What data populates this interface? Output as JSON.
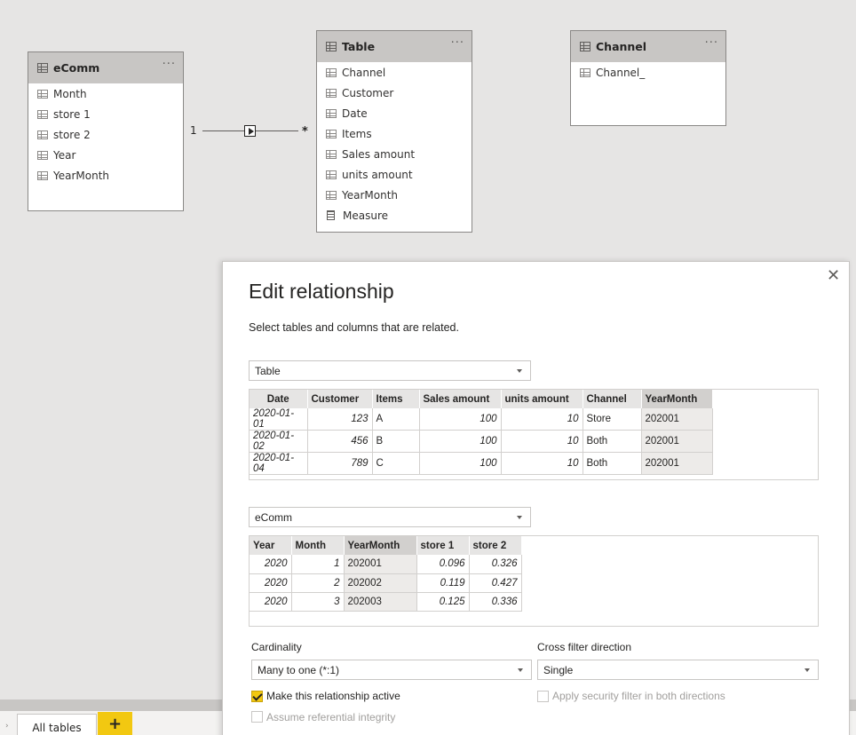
{
  "model": {
    "ecomm": {
      "title": "eComm",
      "more": "···",
      "fields": [
        "Month",
        "store 1",
        "store 2",
        "Year",
        "YearMonth"
      ]
    },
    "table": {
      "title": "Table",
      "more": "···",
      "fields": [
        "Channel",
        "Customer",
        "Date",
        "Items",
        "Sales amount",
        "units amount",
        "YearMonth"
      ],
      "measure": "Measure"
    },
    "channel": {
      "title": "Channel",
      "more": "···",
      "fields": [
        "Channel_"
      ]
    },
    "relationship": {
      "one": "1",
      "many": "*"
    }
  },
  "dialog": {
    "title": "Edit relationship",
    "subtitle": "Select tables and columns that are related.",
    "close": "✕",
    "table1": {
      "selected": "Table",
      "headers": [
        "Date",
        "Customer",
        "Items",
        "Sales amount",
        "units amount",
        "Channel",
        "YearMonth"
      ],
      "rows": [
        [
          "2020-01-01",
          "123",
          "A",
          "100",
          "10",
          "Store",
          "202001"
        ],
        [
          "2020-01-02",
          "456",
          "B",
          "100",
          "10",
          "Both",
          "202001"
        ],
        [
          "2020-01-04",
          "789",
          "C",
          "100",
          "10",
          "Both",
          "202001"
        ]
      ]
    },
    "table2": {
      "selected": "eComm",
      "headers": [
        "Year",
        "Month",
        "YearMonth",
        "store 1",
        "store 2"
      ],
      "rows": [
        [
          "2020",
          "1",
          "202001",
          "0.096",
          "0.326"
        ],
        [
          "2020",
          "2",
          "202002",
          "0.119",
          "0.427"
        ],
        [
          "2020",
          "3",
          "202003",
          "0.125",
          "0.336"
        ]
      ]
    },
    "cardinality": {
      "label": "Cardinality",
      "value": "Many to one (*:1)"
    },
    "cross_filter": {
      "label": "Cross filter direction",
      "value": "Single"
    },
    "options": {
      "active": {
        "label": "Make this relationship active",
        "checked": true
      },
      "security": {
        "label": "Apply security filter in both directions",
        "checked": false
      },
      "referential": {
        "label": "Assume referential integrity",
        "checked": false
      }
    }
  },
  "bottom": {
    "tab_label": "All tables",
    "add_label": "+",
    "scroll_arrow": "›"
  },
  "colors": {
    "accent": "#f2c811",
    "header_bg": "#c8c6c4",
    "canvas_bg": "#e6e5e4"
  }
}
